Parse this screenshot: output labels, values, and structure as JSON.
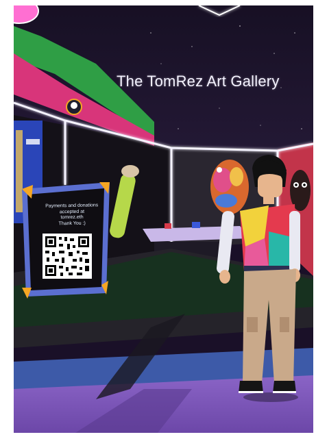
{
  "scene": {
    "title": "The TomRez Art Gallery",
    "sign": {
      "line1": "Payments and donations",
      "line2": "accepted at",
      "line3": "tomrez.eth",
      "line4": "Thank You :)"
    }
  },
  "colors": {
    "sky": "#1c1230",
    "neon": "#f5f3ff",
    "floor_purple": "#7a54b8",
    "floor_dark": "#2c2440",
    "carpet_blue": "#3d5aa8",
    "banner_green": "#2f9e45",
    "banner_pink": "#d8357a",
    "sign_frame": "#5b6fd0",
    "corner_orange": "#f5a623"
  }
}
